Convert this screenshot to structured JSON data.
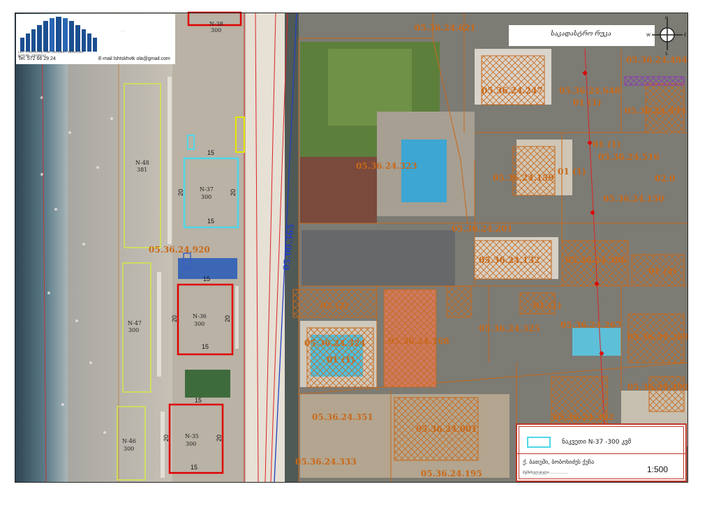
{
  "map": {
    "road_label": "05.00.365",
    "parcels": [
      {
        "id": "p621",
        "label": "05.36.24.621"
      },
      {
        "id": "p494",
        "label": "05.36.24.494"
      },
      {
        "id": "p247",
        "label": "05.36.24.247"
      },
      {
        "id": "p648",
        "label": "05.36.24.648"
      },
      {
        "id": "p648s",
        "label": "01 (1)"
      },
      {
        "id": "p493",
        "label": "05.36.24.493"
      },
      {
        "id": "p516s",
        "label": "01 (1)"
      },
      {
        "id": "p516",
        "label": "05.36.24.516"
      },
      {
        "id": "p323",
        "label": "05.36.24.323"
      },
      {
        "id": "p159",
        "label": "05.36.24.159"
      },
      {
        "id": "p159s",
        "label": "01 (1)"
      },
      {
        "id": "p02",
        "label": "02.0"
      },
      {
        "id": "p150",
        "label": "05.36.24.150"
      },
      {
        "id": "p201",
        "label": "05.36.24.201"
      },
      {
        "id": "p920",
        "label": "05.36.24.920"
      },
      {
        "id": "p132",
        "label": "05.36.24.132"
      },
      {
        "id": "p306",
        "label": "05.36.24.306"
      },
      {
        "id": "p014",
        "label": "01 (4)"
      },
      {
        "id": "p022",
        "label": "02 (2)"
      },
      {
        "id": "p011b",
        "label": "01 (1)"
      },
      {
        "id": "p324",
        "label": "05.36.24.324"
      },
      {
        "id": "p168",
        "label": "05.36.24.168"
      },
      {
        "id": "p325",
        "label": "05.36.24.325"
      },
      {
        "id": "p267",
        "label": "05.36.24.267"
      },
      {
        "id": "p269",
        "label": "05.36.24.269"
      },
      {
        "id": "p324s",
        "label": "01 (1)"
      },
      {
        "id": "p490",
        "label": "05.36.24.490"
      },
      {
        "id": "p302",
        "label": "05.36.24.302"
      },
      {
        "id": "p351",
        "label": "05.36.24.351"
      },
      {
        "id": "p001",
        "label": "05.36.24.001"
      },
      {
        "id": "p333",
        "label": "05.36.24.333"
      },
      {
        "id": "p195",
        "label": "05.36.24.195"
      }
    ],
    "plots": [
      {
        "id": "n38",
        "number": "N-38",
        "area": "300"
      },
      {
        "id": "n48",
        "number": "N-48",
        "area": "381"
      },
      {
        "id": "n37",
        "number": "N-37",
        "area": "300"
      },
      {
        "id": "n47",
        "number": "N-47",
        "area": "300"
      },
      {
        "id": "n36",
        "number": "N-36",
        "area": "300"
      },
      {
        "id": "n46",
        "number": "N-46",
        "area": "300"
      },
      {
        "id": "n35",
        "number": "N-35",
        "area": "300"
      }
    ],
    "dimensions": {
      "short": "15",
      "long": "20"
    }
  },
  "header": {
    "title": "საკადასტრო რუკა",
    "company_line1": "LLC \"CADASTRE AND GEODESY SERVICES\"",
    "company_line2": "BATUMI, GEORGIA",
    "phone_label": "Tel.",
    "phone": "572 66 29 24",
    "email_label": "E-mail",
    "email": "lshtskhvtk ola@gmail.com"
  },
  "compass": {
    "n": "N",
    "s": "S",
    "e": "E",
    "w": "W"
  },
  "legend": {
    "item_label": "ნაკვეთი  N-37 -300  კვმ",
    "owner": "ქ. ბათუმი, ბობოხიძეს ქუჩა",
    "signature": "შემსრულებელი ................",
    "scale": "1:500"
  },
  "colors": {
    "cadastral_line": "#c8691a",
    "red_plot": "#e00000",
    "cyan_plot": "#4fd6e8",
    "yellow_plot": "#d4e84a",
    "road_line": "#2040c0"
  }
}
